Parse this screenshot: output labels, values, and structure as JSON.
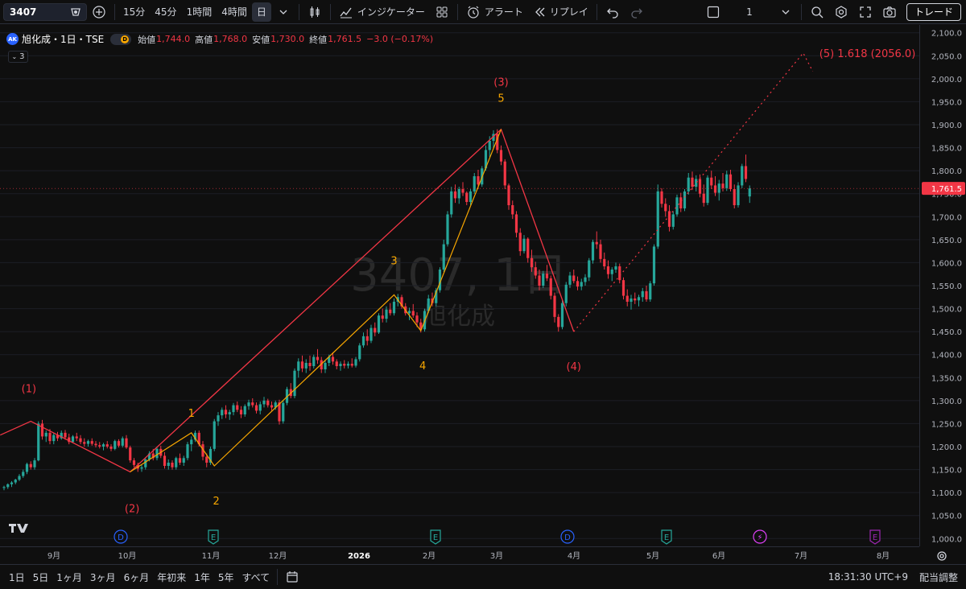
{
  "toolbar": {
    "symbol": "3407",
    "intervals": [
      "15分",
      "45分",
      "1時間",
      "4時間"
    ],
    "active_interval": "日",
    "indicators_label": "インジケーター",
    "alert_label": "アラート",
    "replay_label": "リプレイ",
    "layout_number": "1",
    "trade_label": "トレード"
  },
  "legend": {
    "logo": "AK",
    "title": "旭化成・1日・TSE",
    "badge": "D",
    "open_label": "始値",
    "open": "1,744.0",
    "high_label": "高値",
    "high": "1,768.0",
    "low_label": "安値",
    "low": "1,730.0",
    "close_label": "終値",
    "close": "1,761.5",
    "change": "−3.0 (−0.17%)",
    "indicator_count": "3"
  },
  "watermark": {
    "line1": "3407, 1日",
    "line2": "旭化成"
  },
  "colors": {
    "up": "#26a69a",
    "down": "#f23645",
    "primary_wave": "#f23645",
    "sub_wave": "#f7a600",
    "bg": "#0f0f0f"
  },
  "chart_data": {
    "type": "candlestick",
    "price_axis_ticks": [
      "2,100.0",
      "2,050.0",
      "2,000.0",
      "1,950.0",
      "1,900.0",
      "1,850.0",
      "1,800.0",
      "1,750.0",
      "1,700.0",
      "1,650.0",
      "1,600.0",
      "1,550.0",
      "1,500.0",
      "1,450.0",
      "1,400.0",
      "1,350.0",
      "1,300.0",
      "1,250.0",
      "1,200.0",
      "1,150.0",
      "1,100.0",
      "1,050.0",
      "1,000.0"
    ],
    "ylim": [
      983,
      2117
    ],
    "current_price": "1,761.5",
    "time_axis_ticks": [
      "9月",
      "10月",
      "11月",
      "12月",
      "2026",
      "2月",
      "3月",
      "4月",
      "5月",
      "6月",
      "7月",
      "8月"
    ],
    "event_markers": [
      {
        "text": "D",
        "kind": "dividend"
      },
      {
        "text": "E",
        "kind": "earnings"
      },
      {
        "text": "E",
        "kind": "earnings"
      },
      {
        "text": "D",
        "kind": "dividend"
      },
      {
        "text": "E",
        "kind": "earnings"
      },
      {
        "text": "⚡",
        "kind": "split"
      },
      {
        "text": "E",
        "kind": "earnings"
      }
    ],
    "primary_waves": [
      {
        "label": "(1)",
        "price": 1255
      },
      {
        "label": "(2)",
        "price": 1145
      },
      {
        "label": "(3)",
        "price": 1890
      },
      {
        "label": "(4)",
        "price": 1450
      },
      {
        "label": "(5) 1.618 (2056.0)",
        "price": 2056.0
      }
    ],
    "sub_waves": [
      {
        "label": "1",
        "price": 1230
      },
      {
        "label": "2",
        "price": 1158
      },
      {
        "label": "3",
        "price": 1530
      },
      {
        "label": "4",
        "price": 1452
      },
      {
        "label": "5",
        "price": 1890
      }
    ],
    "ohlc": [
      [
        1110,
        1115,
        1105,
        1112
      ],
      [
        1112,
        1120,
        1108,
        1118
      ],
      [
        1118,
        1125,
        1112,
        1122
      ],
      [
        1122,
        1130,
        1118,
        1128
      ],
      [
        1128,
        1140,
        1125,
        1136
      ],
      [
        1136,
        1150,
        1132,
        1145
      ],
      [
        1145,
        1165,
        1140,
        1162
      ],
      [
        1162,
        1168,
        1150,
        1155
      ],
      [
        1155,
        1175,
        1150,
        1170
      ],
      [
        1170,
        1255,
        1168,
        1250
      ],
      [
        1250,
        1258,
        1215,
        1222
      ],
      [
        1222,
        1235,
        1210,
        1230
      ],
      [
        1230,
        1238,
        1205,
        1212
      ],
      [
        1212,
        1230,
        1205,
        1225
      ],
      [
        1225,
        1232,
        1212,
        1218
      ],
      [
        1218,
        1235,
        1215,
        1230
      ],
      [
        1230,
        1236,
        1215,
        1220
      ],
      [
        1220,
        1228,
        1205,
        1210
      ],
      [
        1210,
        1225,
        1208,
        1222
      ],
      [
        1222,
        1230,
        1212,
        1218
      ],
      [
        1218,
        1225,
        1205,
        1210
      ],
      [
        1210,
        1218,
        1200,
        1206
      ],
      [
        1206,
        1215,
        1200,
        1212
      ],
      [
        1212,
        1218,
        1202,
        1206
      ],
      [
        1206,
        1212,
        1198,
        1203
      ],
      [
        1203,
        1210,
        1196,
        1200
      ],
      [
        1200,
        1208,
        1192,
        1205
      ],
      [
        1205,
        1212,
        1196,
        1200
      ],
      [
        1200,
        1205,
        1190,
        1195
      ],
      [
        1195,
        1215,
        1192,
        1212
      ],
      [
        1212,
        1216,
        1198,
        1202
      ],
      [
        1202,
        1222,
        1198,
        1218
      ],
      [
        1218,
        1225,
        1195,
        1198
      ],
      [
        1198,
        1202,
        1165,
        1170
      ],
      [
        1170,
        1175,
        1155,
        1160
      ],
      [
        1160,
        1165,
        1145,
        1152
      ],
      [
        1152,
        1160,
        1145,
        1155
      ],
      [
        1155,
        1175,
        1150,
        1172
      ],
      [
        1172,
        1190,
        1168,
        1185
      ],
      [
        1185,
        1195,
        1170,
        1175
      ],
      [
        1175,
        1198,
        1170,
        1195
      ],
      [
        1195,
        1202,
        1175,
        1180
      ],
      [
        1180,
        1188,
        1152,
        1158
      ],
      [
        1158,
        1172,
        1150,
        1165
      ],
      [
        1165,
        1170,
        1150,
        1155
      ],
      [
        1155,
        1178,
        1150,
        1175
      ],
      [
        1175,
        1185,
        1160,
        1165
      ],
      [
        1165,
        1180,
        1158,
        1175
      ],
      [
        1175,
        1210,
        1170,
        1205
      ],
      [
        1205,
        1222,
        1190,
        1215
      ],
      [
        1215,
        1235,
        1210,
        1230
      ],
      [
        1230,
        1235,
        1200,
        1205
      ],
      [
        1205,
        1212,
        1170,
        1178
      ],
      [
        1178,
        1185,
        1155,
        1165
      ],
      [
        1165,
        1200,
        1160,
        1195
      ],
      [
        1195,
        1260,
        1190,
        1255
      ],
      [
        1255,
        1275,
        1245,
        1268
      ],
      [
        1268,
        1285,
        1260,
        1280
      ],
      [
        1280,
        1290,
        1262,
        1270
      ],
      [
        1270,
        1280,
        1258,
        1275
      ],
      [
        1275,
        1295,
        1268,
        1290
      ],
      [
        1290,
        1298,
        1275,
        1280
      ],
      [
        1280,
        1288,
        1262,
        1270
      ],
      [
        1270,
        1292,
        1265,
        1288
      ],
      [
        1288,
        1302,
        1280,
        1296
      ],
      [
        1296,
        1305,
        1285,
        1290
      ],
      [
        1290,
        1296,
        1272,
        1278
      ],
      [
        1278,
        1298,
        1270,
        1292
      ],
      [
        1292,
        1308,
        1285,
        1300
      ],
      [
        1300,
        1304,
        1285,
        1290
      ],
      [
        1290,
        1298,
        1278,
        1285
      ],
      [
        1285,
        1300,
        1280,
        1296
      ],
      [
        1296,
        1302,
        1248,
        1255
      ],
      [
        1255,
        1300,
        1250,
        1295
      ],
      [
        1295,
        1330,
        1290,
        1325
      ],
      [
        1325,
        1338,
        1305,
        1310
      ],
      [
        1310,
        1370,
        1305,
        1365
      ],
      [
        1365,
        1392,
        1350,
        1385
      ],
      [
        1385,
        1398,
        1362,
        1370
      ],
      [
        1370,
        1390,
        1360,
        1382
      ],
      [
        1382,
        1398,
        1365,
        1375
      ],
      [
        1375,
        1400,
        1370,
        1395
      ],
      [
        1395,
        1412,
        1380,
        1388
      ],
      [
        1388,
        1395,
        1360,
        1368
      ],
      [
        1368,
        1388,
        1360,
        1382
      ],
      [
        1382,
        1400,
        1375,
        1395
      ],
      [
        1395,
        1405,
        1378,
        1385
      ],
      [
        1385,
        1390,
        1368,
        1375
      ],
      [
        1375,
        1385,
        1365,
        1380
      ],
      [
        1380,
        1388,
        1370,
        1376
      ],
      [
        1376,
        1385,
        1370,
        1380
      ],
      [
        1380,
        1392,
        1372,
        1376
      ],
      [
        1376,
        1395,
        1372,
        1390
      ],
      [
        1390,
        1425,
        1385,
        1420
      ],
      [
        1420,
        1448,
        1415,
        1440
      ],
      [
        1440,
        1455,
        1420,
        1430
      ],
      [
        1430,
        1465,
        1425,
        1458
      ],
      [
        1458,
        1470,
        1440,
        1448
      ],
      [
        1448,
        1490,
        1445,
        1485
      ],
      [
        1485,
        1500,
        1470,
        1478
      ],
      [
        1478,
        1505,
        1470,
        1498
      ],
      [
        1498,
        1512,
        1485,
        1490
      ],
      [
        1490,
        1522,
        1485,
        1515
      ],
      [
        1515,
        1532,
        1505,
        1525
      ],
      [
        1525,
        1530,
        1500,
        1505
      ],
      [
        1505,
        1512,
        1485,
        1490
      ],
      [
        1490,
        1502,
        1475,
        1495
      ],
      [
        1495,
        1510,
        1480,
        1485
      ],
      [
        1485,
        1492,
        1460,
        1470
      ],
      [
        1470,
        1478,
        1448,
        1455
      ],
      [
        1455,
        1500,
        1450,
        1495
      ],
      [
        1495,
        1530,
        1490,
        1522
      ],
      [
        1522,
        1535,
        1505,
        1512
      ],
      [
        1512,
        1545,
        1505,
        1540
      ],
      [
        1540,
        1590,
        1535,
        1585
      ],
      [
        1585,
        1650,
        1580,
        1640
      ],
      [
        1640,
        1712,
        1635,
        1705
      ],
      [
        1705,
        1765,
        1698,
        1755
      ],
      [
        1755,
        1770,
        1730,
        1740
      ],
      [
        1740,
        1765,
        1728,
        1760
      ],
      [
        1760,
        1775,
        1745,
        1752
      ],
      [
        1752,
        1755,
        1725,
        1732
      ],
      [
        1732,
        1760,
        1725,
        1755
      ],
      [
        1755,
        1795,
        1750,
        1788
      ],
      [
        1788,
        1802,
        1760,
        1770
      ],
      [
        1770,
        1810,
        1765,
        1805
      ],
      [
        1805,
        1855,
        1800,
        1845
      ],
      [
        1845,
        1875,
        1830,
        1865
      ],
      [
        1865,
        1888,
        1850,
        1880
      ],
      [
        1880,
        1890,
        1838,
        1845
      ],
      [
        1845,
        1855,
        1812,
        1820
      ],
      [
        1820,
        1825,
        1760,
        1768
      ],
      [
        1768,
        1772,
        1715,
        1725
      ],
      [
        1725,
        1735,
        1695,
        1705
      ],
      [
        1705,
        1712,
        1655,
        1665
      ],
      [
        1665,
        1675,
        1615,
        1625
      ],
      [
        1625,
        1660,
        1620,
        1652
      ],
      [
        1652,
        1655,
        1600,
        1610
      ],
      [
        1610,
        1628,
        1580,
        1590
      ],
      [
        1590,
        1602,
        1565,
        1572
      ],
      [
        1572,
        1585,
        1540,
        1550
      ],
      [
        1550,
        1582,
        1545,
        1576
      ],
      [
        1576,
        1595,
        1560,
        1566
      ],
      [
        1566,
        1572,
        1520,
        1528
      ],
      [
        1528,
        1535,
        1470,
        1482
      ],
      [
        1482,
        1488,
        1450,
        1460
      ],
      [
        1460,
        1520,
        1455,
        1512
      ],
      [
        1512,
        1558,
        1505,
        1552
      ],
      [
        1552,
        1580,
        1545,
        1572
      ],
      [
        1572,
        1585,
        1555,
        1560
      ],
      [
        1560,
        1570,
        1540,
        1548
      ],
      [
        1548,
        1565,
        1540,
        1558
      ],
      [
        1558,
        1575,
        1550,
        1568
      ],
      [
        1568,
        1610,
        1560,
        1605
      ],
      [
        1605,
        1650,
        1598,
        1645
      ],
      [
        1645,
        1668,
        1630,
        1640
      ],
      [
        1640,
        1650,
        1600,
        1608
      ],
      [
        1608,
        1622,
        1585,
        1592
      ],
      [
        1592,
        1605,
        1565,
        1575
      ],
      [
        1575,
        1590,
        1560,
        1585
      ],
      [
        1585,
        1600,
        1578,
        1592
      ],
      [
        1592,
        1598,
        1555,
        1562
      ],
      [
        1562,
        1568,
        1520,
        1528
      ],
      [
        1528,
        1542,
        1505,
        1515
      ],
      [
        1515,
        1530,
        1498,
        1522
      ],
      [
        1522,
        1535,
        1510,
        1518
      ],
      [
        1518,
        1530,
        1505,
        1525
      ],
      [
        1525,
        1545,
        1515,
        1538
      ],
      [
        1538,
        1550,
        1515,
        1520
      ],
      [
        1520,
        1560,
        1515,
        1555
      ],
      [
        1555,
        1640,
        1550,
        1635
      ],
      [
        1635,
        1770,
        1630,
        1755
      ],
      [
        1755,
        1762,
        1720,
        1728
      ],
      [
        1728,
        1740,
        1700,
        1712
      ],
      [
        1712,
        1725,
        1668,
        1678
      ],
      [
        1678,
        1712,
        1672,
        1705
      ],
      [
        1705,
        1748,
        1700,
        1742
      ],
      [
        1742,
        1752,
        1710,
        1718
      ],
      [
        1718,
        1760,
        1712,
        1755
      ],
      [
        1755,
        1795,
        1748,
        1785
      ],
      [
        1785,
        1798,
        1758,
        1765
      ],
      [
        1765,
        1790,
        1755,
        1782
      ],
      [
        1782,
        1792,
        1742,
        1750
      ],
      [
        1750,
        1770,
        1722,
        1730
      ],
      [
        1730,
        1790,
        1725,
        1785
      ],
      [
        1785,
        1800,
        1760,
        1768
      ],
      [
        1768,
        1788,
        1745,
        1752
      ],
      [
        1752,
        1780,
        1735,
        1772
      ],
      [
        1772,
        1795,
        1755,
        1762
      ],
      [
        1762,
        1800,
        1756,
        1792
      ],
      [
        1792,
        1802,
        1755,
        1760
      ],
      [
        1760,
        1770,
        1718,
        1725
      ],
      [
        1725,
        1775,
        1720,
        1768
      ],
      [
        1768,
        1815,
        1762,
        1810
      ],
      [
        1810,
        1835,
        1775,
        1782
      ],
      [
        1744,
        1768,
        1730,
        1761.5
      ]
    ]
  },
  "bottom_bar": {
    "ranges": [
      "1日",
      "5日",
      "1ヶ月",
      "3ヶ月",
      "6ヶ月",
      "年初来",
      "1年",
      "5年",
      "すべて"
    ],
    "time": "18:31:30 UTC+9",
    "adjust_label": "配当調整"
  }
}
